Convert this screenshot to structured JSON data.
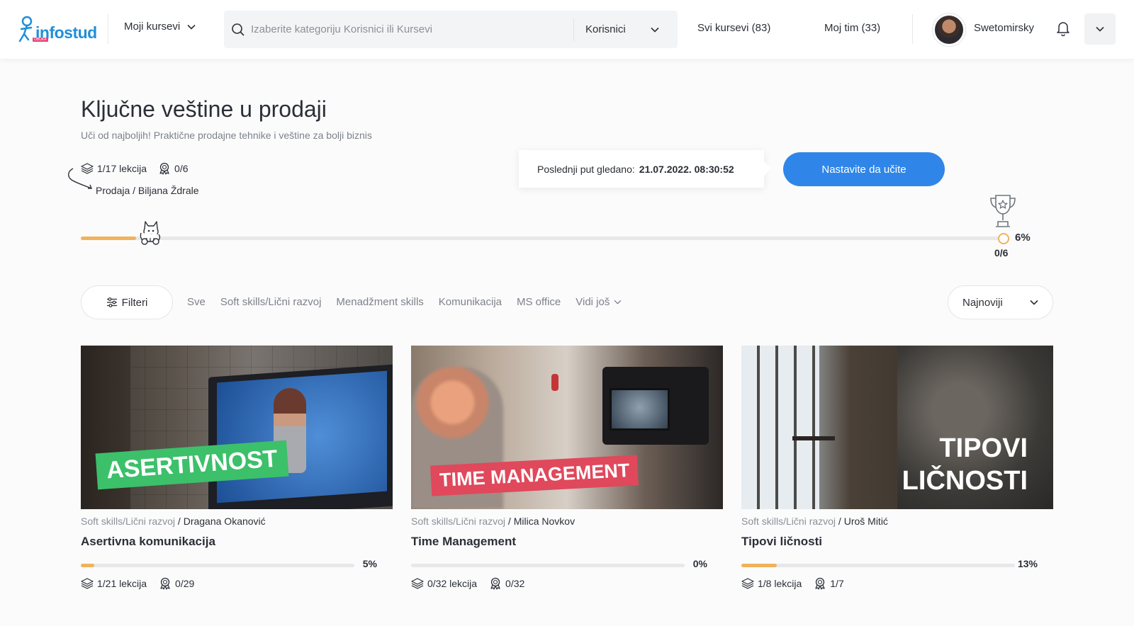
{
  "header": {
    "logo_text": "infostud",
    "logo_sub": "OBUKA",
    "my_courses_label": "Moji kursevi",
    "search": {
      "placeholder": "Izaberite kategoriju Korisnici ili Kursevi",
      "value": ""
    },
    "search_category": "Korisnici",
    "all_courses_label": "Svi kursevi (83)",
    "my_team_label": "Moj tim (33)",
    "user_name": "Swetomirsky"
  },
  "course": {
    "title": "Ključne veštine u prodaji",
    "subtitle": "Uči od najboljih! Praktične prodajne tehnike i veštine za bolji biznis",
    "lessons": "1/17 lekcija",
    "badges": "0/6",
    "breadcrumb": "Prodaja / Biljana Ždrale",
    "last_seen_label": "Poslednji put gledano:",
    "last_seen_value": "21.07.2022. 08:30:52",
    "continue_label": "Nastavite da učite",
    "progress_fraction": 0.06,
    "goal_pct": "6%",
    "goal_count": "0/6"
  },
  "filters": {
    "button_label": "Filteri",
    "tabs": [
      "Sve",
      "Soft skills/Lični razvoj",
      "Menadžment skills",
      "Komunikacija",
      "MS office"
    ],
    "more_label": "Vidi još",
    "sort_label": "Najnoviji"
  },
  "cards": [
    {
      "banner": "ASERTIVNOST",
      "category": "Soft skills/Lični razvoj",
      "author": " / Dragana Okanović",
      "title": "Asertivna komunikacija",
      "progress": 0.05,
      "pct": "5%",
      "lessons": "1/21 lekcija",
      "badges": "0/29"
    },
    {
      "banner": "TIME MANAGEMENT",
      "category": "Soft skills/Lični razvoj",
      "author": " / Milica Novkov",
      "title": "Time Management",
      "progress": 0.0,
      "pct": "0%",
      "lessons": "0/32 lekcija",
      "badges": "0/32"
    },
    {
      "banner_line1": "TIPOVI",
      "banner_line2": "LIČNOSTI",
      "category": "Soft skills/Lični razvoj",
      "author": " / Uroš Mitić",
      "title": "Tipovi ličnosti",
      "progress": 0.13,
      "pct": "13%",
      "lessons": "1/8 lekcija",
      "badges": "1/7"
    }
  ],
  "colors": {
    "accent": "#2f86e8",
    "progress": "#f1b25b",
    "logo": "#1f8fd9",
    "banner_green": "#3cc06a",
    "banner_red": "#e0485c"
  },
  "icons": [
    "search-icon",
    "chevron-down-icon",
    "bell-icon",
    "layers-icon",
    "badge-icon",
    "trophy-icon",
    "cat-mascot-icon",
    "sliders-icon",
    "curved-arrow-icon"
  ]
}
